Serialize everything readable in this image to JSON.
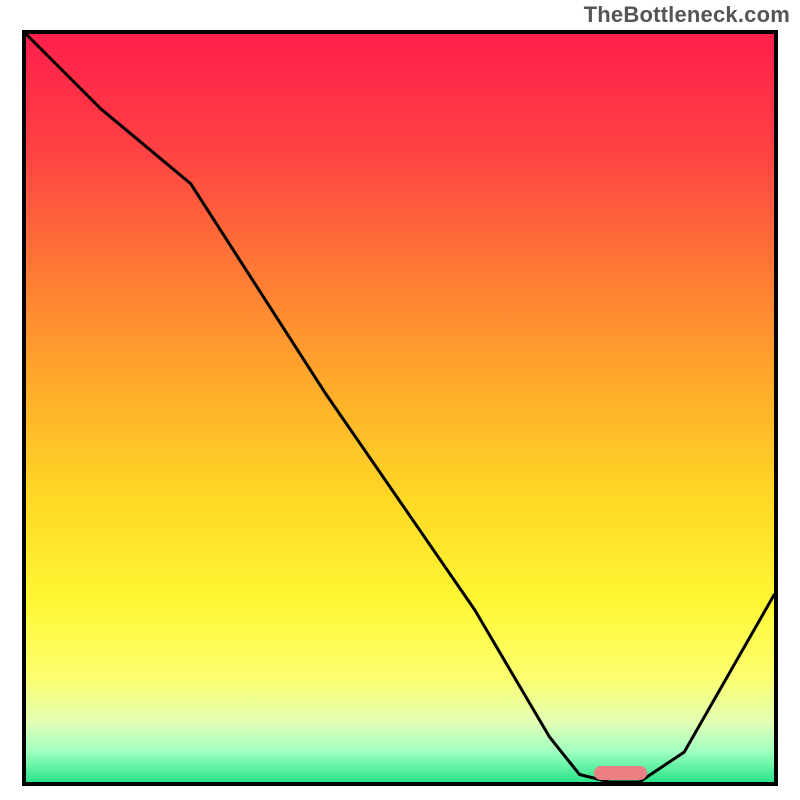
{
  "watermark": "TheBottleneck.com",
  "chart_data": {
    "type": "line",
    "title": "",
    "xlabel": "",
    "ylabel": "",
    "xlim": [
      0,
      100
    ],
    "ylim": [
      0,
      100
    ],
    "series": [
      {
        "name": "curve",
        "x": [
          0,
          10,
          22,
          40,
          60,
          70,
          74,
          78,
          82,
          88,
          100
        ],
        "y": [
          100,
          90,
          80,
          52,
          23,
          6,
          1,
          0,
          0,
          4,
          25
        ]
      }
    ],
    "marker": {
      "x_start": 76,
      "x_end": 83,
      "y": 0
    },
    "gradient_stops": [
      {
        "pos": 0.0,
        "color": "#ff1f4b"
      },
      {
        "pos": 0.15,
        "color": "#ff4044"
      },
      {
        "pos": 0.32,
        "color": "#ff7a35"
      },
      {
        "pos": 0.48,
        "color": "#ffae2a"
      },
      {
        "pos": 0.62,
        "color": "#ffd825"
      },
      {
        "pos": 0.76,
        "color": "#fff734"
      },
      {
        "pos": 0.86,
        "color": "#fdff70"
      },
      {
        "pos": 0.92,
        "color": "#e3ffb5"
      },
      {
        "pos": 0.96,
        "color": "#9effc0"
      },
      {
        "pos": 1.0,
        "color": "#29e58a"
      }
    ]
  }
}
